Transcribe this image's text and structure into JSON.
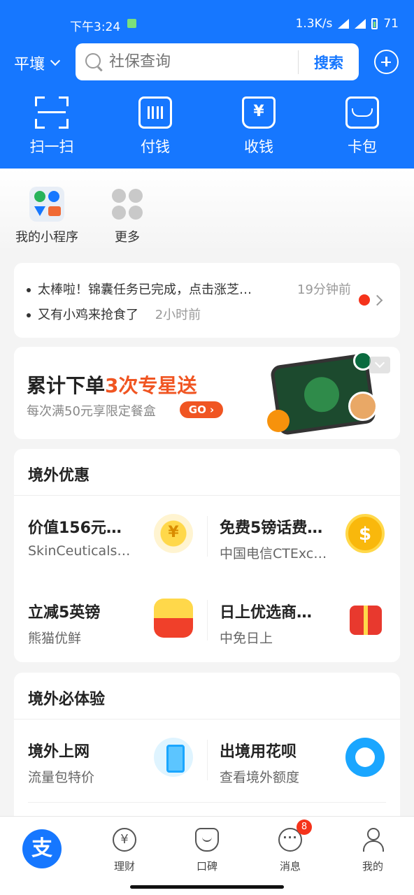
{
  "status_bar": {
    "time": "下午3:24",
    "network_speed": "1.3K/s",
    "battery": "71"
  },
  "header": {
    "city": "平壤",
    "search_placeholder": "社保查询",
    "search_button": "搜索",
    "quick_actions": [
      {
        "label": "扫一扫",
        "icon": "scan-icon"
      },
      {
        "label": "付钱",
        "icon": "pay-icon"
      },
      {
        "label": "收钱",
        "icon": "receive-money-icon"
      },
      {
        "label": "卡包",
        "icon": "card-wallet-icon"
      }
    ]
  },
  "apps": [
    {
      "label": "我的小程序",
      "icon": "mini-program-icon"
    },
    {
      "label": "更多",
      "icon": "more-icon"
    }
  ],
  "notice": {
    "line1": "太棒啦！锦囊任务已完成，点击涨芝…",
    "line1_time": "19分钟前",
    "line2": "又有小鸡来抢食了",
    "line2_time": "2小时前"
  },
  "banner": {
    "title_main": "累计下单",
    "title_highlight": "3次专星送",
    "subtitle": "每次满50元享限定餐盒",
    "button": "GO ›"
  },
  "overseas_offers": {
    "title": "境外优惠",
    "items": [
      {
        "title": "价值156元…",
        "subtitle": "SkinCeuticals…",
        "icon": "coupon-icon"
      },
      {
        "title": "免费5镑话费…",
        "subtitle": "中国电信CTExc…",
        "icon": "coin-icon"
      },
      {
        "title": "立减5英镑",
        "subtitle": "熊猫优鲜",
        "icon": "red-packet-icon"
      },
      {
        "title": "日上优选商…",
        "subtitle": "中免日上",
        "icon": "gift-box-icon"
      }
    ]
  },
  "overseas_experience": {
    "title": "境外必体验",
    "items": [
      {
        "title": "境外上网",
        "subtitle": "流量包特价",
        "icon": "phone-signal-icon"
      },
      {
        "title": "出境用花呗",
        "subtitle": "查看境外额度",
        "icon": "huabei-icon"
      }
    ]
  },
  "bottom_nav": {
    "home": "支",
    "items": [
      {
        "label": "理财",
        "icon": "wealth-icon"
      },
      {
        "label": "口碑",
        "icon": "koubei-icon"
      },
      {
        "label": "消息",
        "icon": "message-icon"
      },
      {
        "label": "我的",
        "icon": "profile-icon"
      }
    ],
    "message_badge": "8"
  },
  "colors": {
    "brand": "#1677ff",
    "highlight": "#f05522",
    "badge": "#f5331b"
  }
}
